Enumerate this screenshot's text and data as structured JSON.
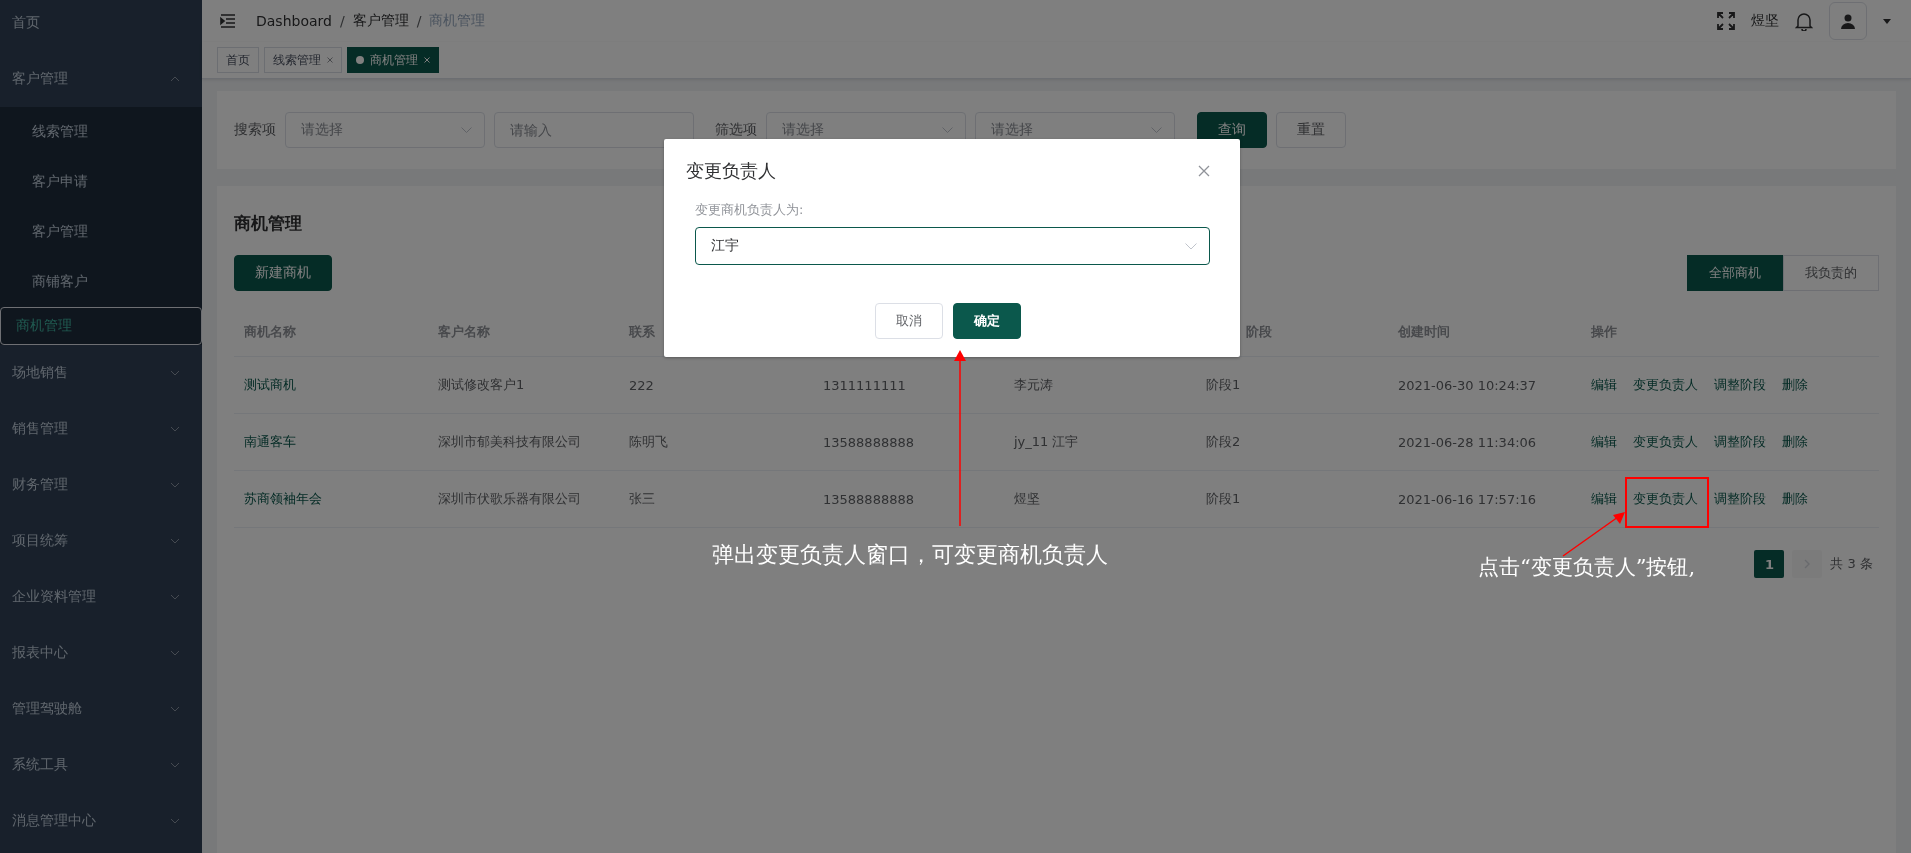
{
  "sidebar": {
    "items": [
      {
        "label": "首页",
        "kind": "link",
        "selected": false
      },
      {
        "label": "客户管理",
        "kind": "group",
        "expanded": true,
        "children": [
          {
            "label": "线索管理",
            "selected": false
          },
          {
            "label": "客户申请",
            "selected": false
          },
          {
            "label": "客户管理",
            "selected": false
          },
          {
            "label": "商铺客户",
            "selected": false
          },
          {
            "label": "商机管理",
            "selected": true
          }
        ]
      },
      {
        "label": "场地销售",
        "kind": "group",
        "expanded": false
      },
      {
        "label": "销售管理",
        "kind": "group",
        "expanded": false
      },
      {
        "label": "财务管理",
        "kind": "group",
        "expanded": false
      },
      {
        "label": "项目统筹",
        "kind": "group",
        "expanded": false
      },
      {
        "label": "企业资料管理",
        "kind": "group",
        "expanded": false
      },
      {
        "label": "报表中心",
        "kind": "group",
        "expanded": false
      },
      {
        "label": "管理驾驶舱",
        "kind": "group",
        "expanded": false
      },
      {
        "label": "系统工具",
        "kind": "group",
        "expanded": false
      },
      {
        "label": "消息管理中心",
        "kind": "group",
        "expanded": false
      }
    ]
  },
  "header": {
    "breadcrumb": [
      "Dashboard",
      "客户管理",
      "商机管理"
    ],
    "separator": "/",
    "user_name": "煜坚"
  },
  "tags": [
    {
      "label": "首页",
      "selected": false,
      "closable": false
    },
    {
      "label": "线索管理",
      "selected": false,
      "closable": true
    },
    {
      "label": "商机管理",
      "selected": true,
      "closable": true
    }
  ],
  "filters": {
    "search_label": "搜索项",
    "search_select": {
      "placeholder": "请选择"
    },
    "search_input": {
      "placeholder": "请输入"
    },
    "filter_label": "筛选项",
    "filter_selects": [
      {
        "placeholder": "请选择"
      },
      {
        "placeholder": "请选择"
      }
    ],
    "query_button": "查询",
    "reset_button": "重置"
  },
  "panel": {
    "title": "商机管理",
    "new_button": "新建商机",
    "scope_toggle": [
      {
        "label": "全部商机",
        "selected": true
      },
      {
        "label": "我负责的",
        "selected": false
      }
    ]
  },
  "table": {
    "columns": [
      {
        "label": "商机名称"
      },
      {
        "label": "客户名称"
      },
      {
        "label": "联系"
      },
      {},
      {},
      {
        "label": "阶段"
      },
      {
        "label": "创建时间"
      },
      {
        "label": "操作"
      }
    ],
    "rows": [
      {
        "name": "测试商机",
        "customer": "测试修改客户1",
        "contact": "222",
        "phone": "1311111111",
        "owner": "李元涛",
        "stage": "阶段1",
        "created": "2021-06-30 10:24:37",
        "actions": [
          "编辑",
          "变更负责人",
          "调整阶段",
          "删除"
        ]
      },
      {
        "name": "南通客车",
        "customer": "深圳市郁美科技有限公司",
        "contact": "陈明飞",
        "phone": "13588888888",
        "owner": "jy_11 江宇",
        "stage": "阶段2",
        "created": "2021-06-28 11:34:06",
        "actions": [
          "编辑",
          "变更负责人",
          "调整阶段",
          "删除"
        ]
      },
      {
        "name": "苏商领袖年会",
        "customer": "深圳市伏歌乐器有限公司",
        "contact": "张三",
        "phone": "13588888888",
        "owner": "煜坚",
        "stage": "阶段1",
        "created": "2021-06-16 17:57:16",
        "actions": [
          "编辑",
          "变更负责人",
          "调整阶段",
          "删除"
        ]
      }
    ]
  },
  "pagination": {
    "pages": [
      {
        "label": "1",
        "selected": true
      }
    ],
    "next_disabled": true,
    "total": "共 3 条"
  },
  "modal": {
    "title": "变更负责人",
    "field_label": "变更商机负责人为:",
    "field_value": "江宇",
    "cancel_button": "取消",
    "confirm_button": "确定"
  },
  "annotations": [
    {
      "kind": "arrow-up",
      "text": "弹出变更负责人窗口，可变更商机负责人"
    },
    {
      "kind": "highlight",
      "text": "点击“变更负责人”按钮,"
    }
  ]
}
